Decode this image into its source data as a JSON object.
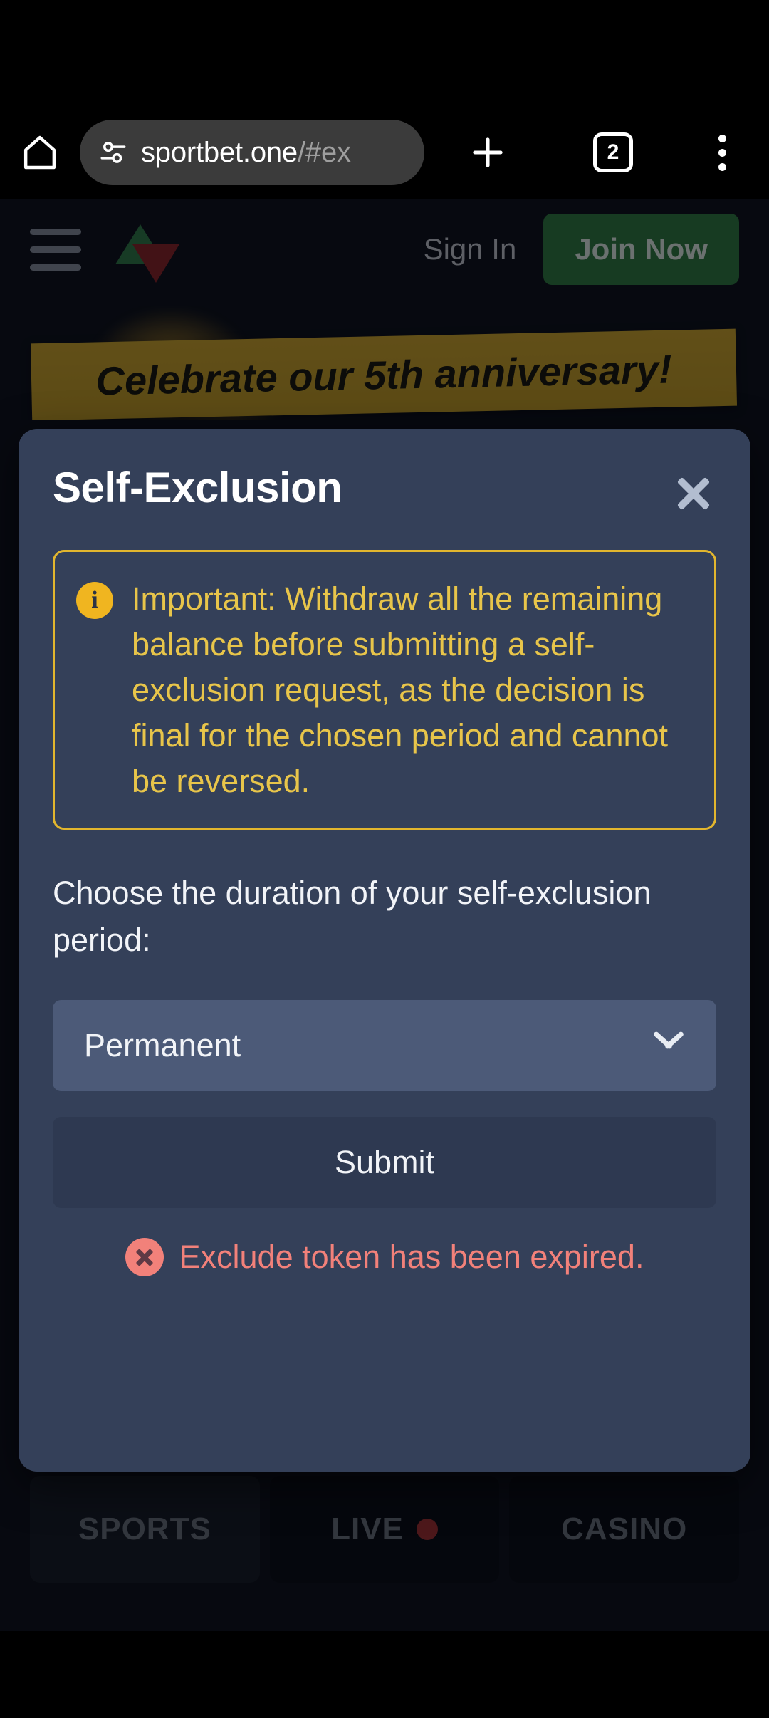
{
  "browser": {
    "home_icon": "home-icon",
    "permissions_icon": "tune-permissions-icon",
    "url_host": "sportbet.one",
    "url_path": "/#ex",
    "new_tab_icon": "plus-icon",
    "tab_count": "2",
    "overflow_icon": "three-dot-menu-icon"
  },
  "site_header": {
    "menu_icon": "hamburger-menu-icon",
    "logo_icon": "sportbet-triangles-logo",
    "sign_in_label": "Sign In",
    "join_now_label": "Join Now"
  },
  "promo": {
    "text": "Celebrate our 5th anniversary!"
  },
  "modal": {
    "title": "Self-Exclusion",
    "close_icon": "close-icon",
    "warning": {
      "icon": "info-icon",
      "glyph": "i",
      "text": "Important: Withdraw all the remaining balance before submitting a self-exclusion request, as the decision is final for the chosen period and cannot be reversed."
    },
    "prompt": "Choose the duration of your self-exclusion period:",
    "duration_select": {
      "value": "Permanent",
      "chevron_icon": "chevron-down-icon"
    },
    "submit_label": "Submit",
    "error": {
      "icon": "error-circle-x-icon",
      "text": "Exclude token has been expired."
    }
  },
  "bottom_tabs": [
    {
      "label": "SPORTS",
      "has_live_dot": false
    },
    {
      "label": "LIVE",
      "has_live_dot": true
    },
    {
      "label": "CASINO",
      "has_live_dot": false
    }
  ],
  "colors": {
    "panel": "#344059",
    "select": "#4c5a78",
    "submit": "#2e3951",
    "warning_border": "#e2b62e",
    "warning_text": "#e8c54a",
    "info_icon": "#f0b520",
    "error": "#f2817a",
    "join_now": "#2f7d3f",
    "promo_bg": "#d3a828",
    "page_bg": "#0c0f17"
  }
}
